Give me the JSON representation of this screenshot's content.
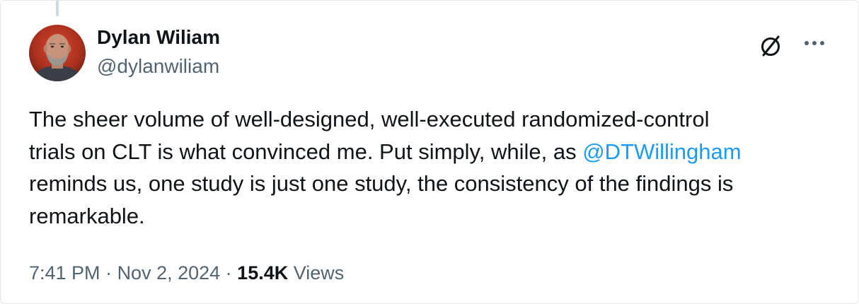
{
  "author": {
    "name": "Dylan Wiliam",
    "handle": "@dylanwiliam",
    "avatar_icon": "profile-photo"
  },
  "actions": {
    "grok_icon": "grok-icon",
    "more_icon": "more-options-icon"
  },
  "tweet": {
    "line1": "The sheer volume of well-designed, well-executed randomized-control",
    "line2_before": "trials on CLT is what convinced me. Put simply, while, as ",
    "mention": "@DTWillingham",
    "line3": "reminds us, one study is just one study, the consistency of the findings is",
    "line4": "remarkable."
  },
  "meta": {
    "time": "7:41 PM",
    "sep1": " · ",
    "date": "Nov 2, 2024",
    "sep2": " · ",
    "views_count": "15.4K",
    "views_label": " Views"
  },
  "colors": {
    "text": "#0f1419",
    "secondary": "#536471",
    "link": "#1d9bf0",
    "thread": "#cfd9de"
  }
}
